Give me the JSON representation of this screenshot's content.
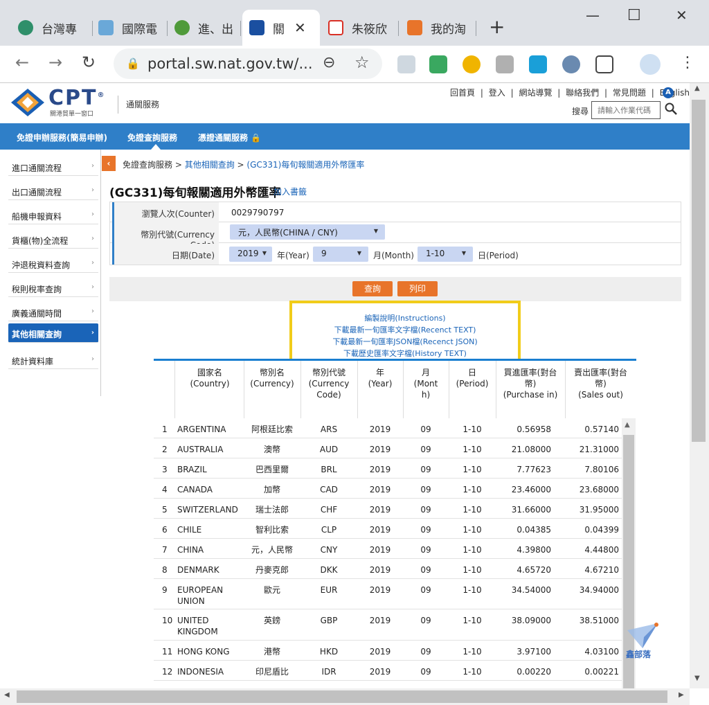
{
  "browser": {
    "tabs": [
      {
        "label": "台灣專",
        "color": "#2f8f6a"
      },
      {
        "label": "國際電",
        "color": "#6aa8d8"
      },
      {
        "label": "進、出",
        "color": "#4f9a3a"
      },
      {
        "label": "關",
        "color": "#1a4fa0",
        "active": true
      },
      {
        "label": "朱筱欣",
        "color": "#d93025"
      },
      {
        "label": "我的淘",
        "color": "#e8742a"
      }
    ],
    "close_glyph": "✕",
    "new_tab_glyph": "+",
    "url": "portal.sw.nat.gov.tw/...",
    "back_glyph": "←",
    "forward_glyph": "→",
    "reload_glyph": "↻",
    "lock_glyph": "🔒",
    "zoom_glyph": "⊖",
    "star_glyph": "☆",
    "menu_glyph": "⋮",
    "min_glyph": "—",
    "max_glyph": "☐",
    "winclose_glyph": "✕"
  },
  "header": {
    "logo_text": "CPT",
    "logo_reg": "®",
    "logo_sub": "關港貿單一窗口",
    "service_name": "通關服務",
    "top_links": [
      "回首頁",
      "|",
      "登入",
      "|",
      "網站導覽",
      "|",
      "聯絡我們",
      "|",
      "常見問題",
      "|",
      "English"
    ],
    "lang_badge": "A",
    "search_label": "搜尋",
    "search_placeholder": "請輸入作業代碼",
    "search_glyph": "⚲"
  },
  "nav": {
    "items": [
      "免證申辦服務(簡易申辦)",
      "免證查詢服務",
      "憑證通關服務 🔒"
    ]
  },
  "sidebar": {
    "items": [
      {
        "label": "進口通關流程"
      },
      {
        "label": "出口通關流程"
      },
      {
        "label": "船機申報資料"
      },
      {
        "label": "貨櫃(物)全流程"
      },
      {
        "label": "沖退稅資料查詢"
      },
      {
        "label": "稅則稅率查詢"
      },
      {
        "label": "廣義通關時間"
      },
      {
        "label": "其他相關查詢",
        "active": true
      },
      {
        "label": "統計資料庫"
      }
    ],
    "chevron": "›"
  },
  "breadcrumb": {
    "back_glyph": "‹",
    "home": "免證查詢服務",
    "sep": " > ",
    "level2": "其他相關查詢",
    "level3": "(GC331)每旬報關適用外幣匯率"
  },
  "page": {
    "title": "(GC331)每旬報關適用外幣匯率",
    "bookmark": "加入書籤"
  },
  "form": {
    "counter_label": "瀏覽人次(Counter)",
    "counter_value": "0029790797",
    "currency_label": "幣別代號(Currency Code)",
    "currency_value": "元，人民幣(CHINA / CNY)",
    "date_label": "日期(Date)",
    "year_value": "2019",
    "year_unit": "年(Year)",
    "month_value": "9",
    "month_unit": "月(Month)",
    "period_value": "1-10",
    "period_unit": "日(Period)",
    "arrow": "▼"
  },
  "buttons": {
    "query": "查詢",
    "print": "列印"
  },
  "links": {
    "instructions": "編製說明(Instructions)",
    "recent_text": "下載最新一旬匯率文字檔(Recenct TEXT)",
    "recent_json": "下載最新一旬匯率JSON檔(Recenct JSON)",
    "history_text": "下載歷史匯率文字檔(History TEXT)"
  },
  "table": {
    "headers": {
      "country": [
        "國家名",
        "(Country)"
      ],
      "currency": [
        "幣別名",
        "(Currency)"
      ],
      "code": [
        "幣別代號",
        "(Currency",
        "Code)"
      ],
      "year": [
        "年",
        "(Year)"
      ],
      "month": [
        "月",
        "(Mont",
        "h)"
      ],
      "period": [
        "日",
        "(Period)"
      ],
      "buy": [
        "買進匯率(對台",
        "幣)",
        "(Purchase in)"
      ],
      "sell": [
        "賣出匯率(對台",
        "幣)",
        "(Sales out)"
      ]
    },
    "rows": [
      {
        "idx": "1",
        "country": "ARGENTINA",
        "currency": "阿根廷比索",
        "code": "ARS",
        "year": "2019",
        "month": "09",
        "period": "1-10",
        "buy": "0.56958",
        "sell": "0.57140"
      },
      {
        "idx": "2",
        "country": "AUSTRALIA",
        "currency": "澳幣",
        "code": "AUD",
        "year": "2019",
        "month": "09",
        "period": "1-10",
        "buy": "21.08000",
        "sell": "21.31000"
      },
      {
        "idx": "3",
        "country": "BRAZIL",
        "currency": "巴西里爾",
        "code": "BRL",
        "year": "2019",
        "month": "09",
        "period": "1-10",
        "buy": "7.77623",
        "sell": "7.80106"
      },
      {
        "idx": "4",
        "country": "CANADA",
        "currency": "加幣",
        "code": "CAD",
        "year": "2019",
        "month": "09",
        "period": "1-10",
        "buy": "23.46000",
        "sell": "23.68000"
      },
      {
        "idx": "5",
        "country": "SWITZERLAND",
        "currency": "瑞士法郎",
        "code": "CHF",
        "year": "2019",
        "month": "09",
        "period": "1-10",
        "buy": "31.66000",
        "sell": "31.95000"
      },
      {
        "idx": "6",
        "country": "CHILE",
        "currency": "智利比索",
        "code": "CLP",
        "year": "2019",
        "month": "09",
        "period": "1-10",
        "buy": "0.04385",
        "sell": "0.04399"
      },
      {
        "idx": "7",
        "country": "CHINA",
        "currency": "元，人民幣",
        "code": "CNY",
        "year": "2019",
        "month": "09",
        "period": "1-10",
        "buy": "4.39800",
        "sell": "4.44800"
      },
      {
        "idx": "8",
        "country": "DENMARK",
        "currency": "丹麥克郎",
        "code": "DKK",
        "year": "2019",
        "month": "09",
        "period": "1-10",
        "buy": "4.65720",
        "sell": "4.67210"
      },
      {
        "idx": "9",
        "country": "EUROPEAN UNION",
        "currency": "歐元",
        "code": "EUR",
        "year": "2019",
        "month": "09",
        "period": "1-10",
        "buy": "34.54000",
        "sell": "34.94000"
      },
      {
        "idx": "10",
        "country": "UNITED KINGDOM",
        "currency": "英鎊",
        "code": "GBP",
        "year": "2019",
        "month": "09",
        "period": "1-10",
        "buy": "38.09000",
        "sell": "38.51000"
      },
      {
        "idx": "11",
        "country": "HONG KONG",
        "currency": "港幣",
        "code": "HKD",
        "year": "2019",
        "month": "09",
        "period": "1-10",
        "buy": "3.97100",
        "sell": "4.03100"
      },
      {
        "idx": "12",
        "country": "INDONESIA",
        "currency": "印尼盾比",
        "code": "IDR",
        "year": "2019",
        "month": "09",
        "period": "1-10",
        "buy": "0.00220",
        "sell": "0.00221"
      }
    ]
  },
  "scroll": {
    "up": "▲",
    "down": "▼",
    "left": "◀",
    "right": "▶"
  },
  "watermark": "鑫部落"
}
